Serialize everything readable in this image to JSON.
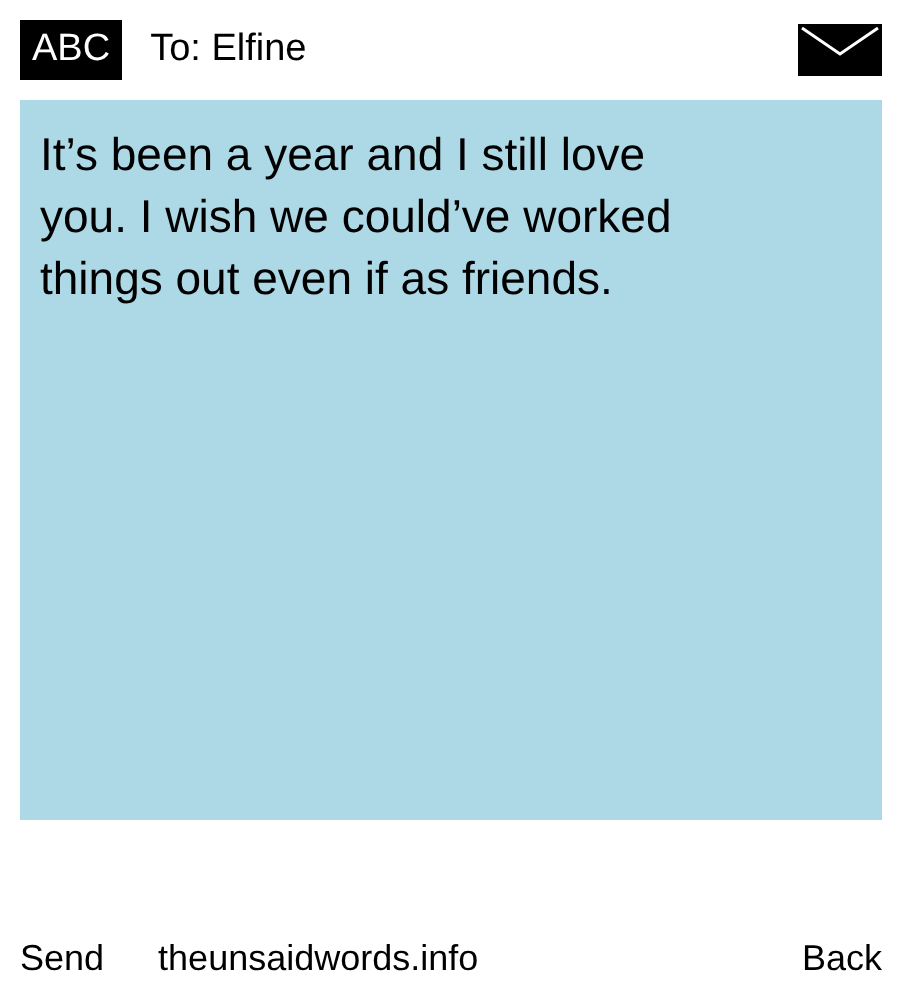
{
  "header": {
    "mode": "ABC",
    "recipient": "To: Elfine"
  },
  "message": {
    "text": "It’s been a year and I still love you. I wish we could’ve worked things out even if as friends."
  },
  "footer": {
    "left": "Send",
    "site": "theunsaidwords.info",
    "right": "Back"
  }
}
